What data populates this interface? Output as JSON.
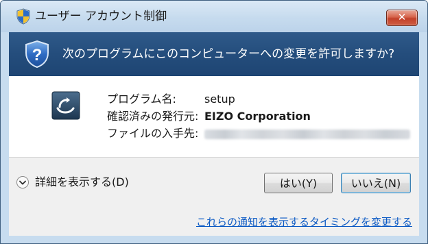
{
  "window": {
    "title": "ユーザー アカウント制御",
    "close_label": "✕"
  },
  "header": {
    "question": "次のプログラムにこのコンピューターへの変更を許可しますか?"
  },
  "details_rows": [
    {
      "label": "プログラム名:",
      "value": "setup"
    },
    {
      "label": "確認済みの発行元:",
      "value": "EIZO Corporation"
    },
    {
      "label": "ファイルの入手先:",
      "value": ""
    }
  ],
  "footer": {
    "show_details_label": "詳細を表示する(D)",
    "yes_label": "はい(Y)",
    "no_label": "いいえ(N)",
    "notification_link": "これらの通知を表示するタイミングを変更する"
  },
  "icons": {
    "title": "uac-shield-icon",
    "header": "question-shield-icon",
    "program": "setup-program-icon",
    "expand": "chevron-down-icon"
  },
  "colors": {
    "header_band": "#244d7c",
    "link": "#0a59c4",
    "close_button": "#c2412a"
  }
}
